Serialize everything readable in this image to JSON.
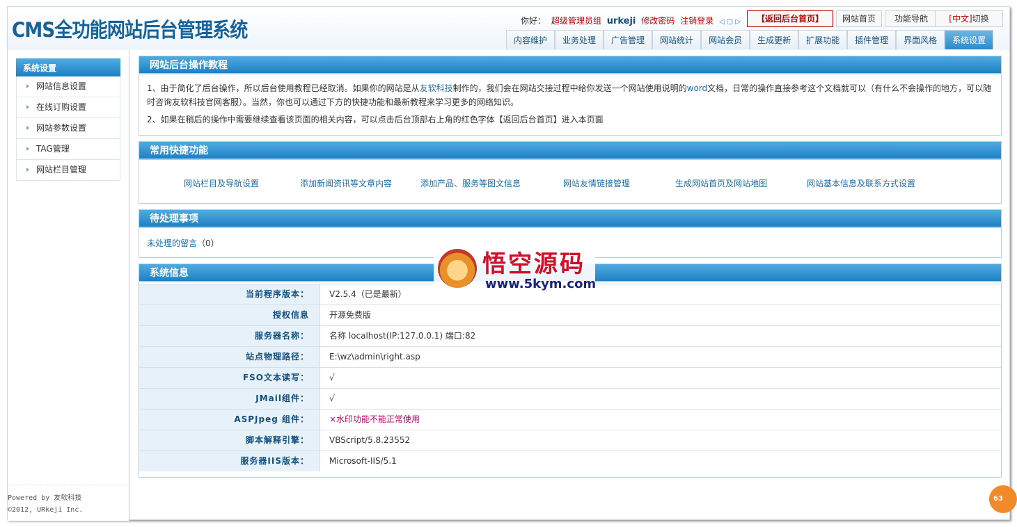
{
  "header": {
    "logo_text": "CMS全功能网站后台管理系统",
    "greeting": "你好：",
    "role": "超级管理员组",
    "username": "urkeji",
    "change_password": "修改密码",
    "logout": "注销登录",
    "back_home": "【返回后台首页】",
    "site_home": "网站首页",
    "func_nav": "功能导航",
    "lang_switch_prefix": "[中文]",
    "lang_switch_suffix": "切换"
  },
  "nav_tabs": [
    "内容维护",
    "业务处理",
    "广告管理",
    "网站统计",
    "网站会员",
    "生成更新",
    "扩展功能",
    "插件管理",
    "界面风格",
    "系统设置"
  ],
  "active_tab": "系统设置",
  "sidebar": {
    "title": "系统设置",
    "items": [
      "网站信息设置",
      "在线订购设置",
      "网站参数设置",
      "TAG管理",
      "网站栏目管理"
    ],
    "powered_line1": "Powered by 友软科技",
    "powered_line2": "©2012, URkeji Inc."
  },
  "tutorial": {
    "title": "网站后台操作教程",
    "p1_a": "1、由于简化了后台操作，所以后台使用教程已经取消。如果你的网站是从",
    "p1_link": "友软科技",
    "p1_b": "制作的，我们会在网站交接过程中给你发送一个网站使用说明的",
    "p1_word": "word",
    "p1_c": "文档，日常的操作直接参考这个文档就可以（有什么不会操作的地方，可以随时咨询友软科技官网客服）。当然，你也可以通过下方的快捷功能和最新教程来学习更多的网络知识。",
    "p2": "2、如果在稍后的操作中需要继续查看该页面的相关内容，可以点击后台顶部右上角的红色字体【返回后台首页】进入本页面"
  },
  "shortcuts": {
    "title": "常用快捷功能",
    "items": [
      "网站栏目及导航设置",
      "添加新闻资讯等文章内容",
      "添加产品、服务等图文信息",
      "网站友情链接管理",
      "生成网站首页及网站地图",
      "网站基本信息及联系方式设置"
    ]
  },
  "pending": {
    "title": "待处理事项",
    "label": "未处理的留言",
    "count_text": "（0）"
  },
  "sysinfo": {
    "title": "系统信息",
    "rows": [
      {
        "label": "当前程序版本：",
        "value": "V2.5.4（已是最新）"
      },
      {
        "label": "授权信息",
        "value": "开源免费版"
      },
      {
        "label": "服务器名称：",
        "value": "名称 localhost(IP:127.0.0.1) 端口:82"
      },
      {
        "label": "站点物理路径：",
        "value": "E:\\wz\\admin\\right.asp"
      },
      {
        "label": "FSO文本读写：",
        "value": "√"
      },
      {
        "label": "JMail组件：",
        "value": "√"
      },
      {
        "label": "ASPJpeg 组件：",
        "value": "×水印功能不能正常使用"
      },
      {
        "label": "脚本解释引擎：",
        "value": "VBScript/5.8.23552"
      },
      {
        "label": "服务器IIS版本：",
        "value": "Microsoft-IIS/5.1"
      }
    ]
  },
  "watermark": {
    "title": "悟空源码",
    "url": "www.5kym.com"
  },
  "badge": "63",
  "colors": {
    "brand_blue": "#1d80c5",
    "header_text": "#14507e",
    "alert_red": "#c00000",
    "warning_magenta": "#c0006a"
  }
}
